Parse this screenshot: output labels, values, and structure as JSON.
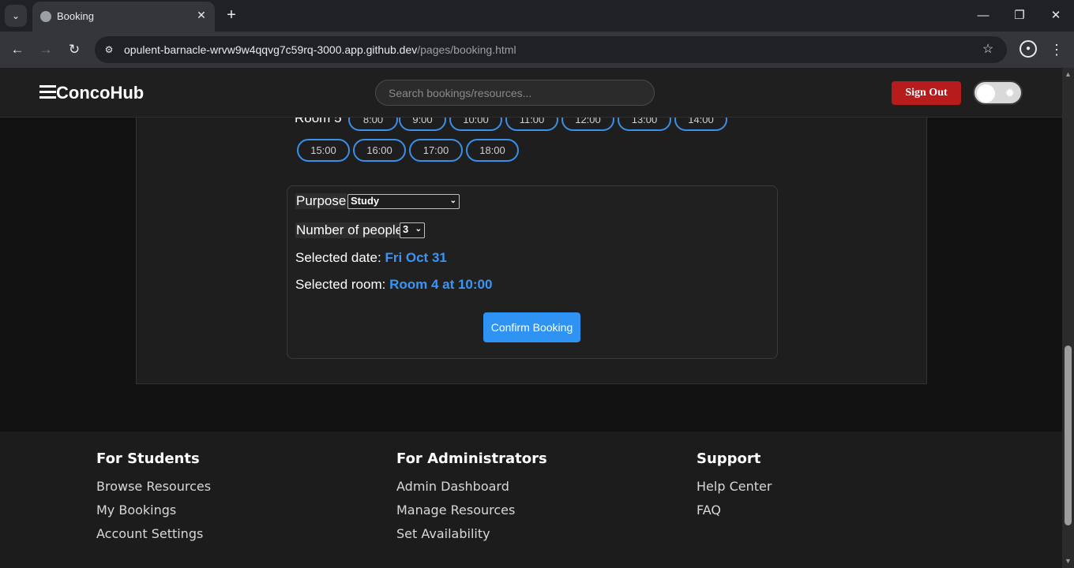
{
  "browser": {
    "tab_title": "Booking",
    "url_host": "opulent-barnacle-wrvw9w4qqvg7c59rq-3000.app.github.dev",
    "url_path": "/pages/booking.html"
  },
  "header": {
    "brand": "ConcoHub",
    "search_placeholder": "Search bookings/resources...",
    "signout_label": "Sign Out"
  },
  "booking": {
    "room5_label": "Room 5",
    "slots_row1": [
      "8:00",
      "9:00",
      "10:00",
      "11:00",
      "12:00",
      "13:00",
      "14:00"
    ],
    "slots_row2": [
      "15:00",
      "16:00",
      "17:00",
      "18:00"
    ],
    "purpose_label": "Purpose",
    "purpose_value": "Study",
    "people_label": "Number of people",
    "people_value": "3",
    "selected_date_label": "Selected date:",
    "selected_date_value": "Fri Oct 31",
    "selected_room_label": "Selected room:",
    "selected_room_value": "Room 4 at 10:00",
    "confirm_label": "Confirm Booking"
  },
  "footer": {
    "students": {
      "title": "For Students",
      "links": [
        "Browse Resources",
        "My Bookings",
        "Account Settings"
      ]
    },
    "admins": {
      "title": "For Administrators",
      "links": [
        "Admin Dashboard",
        "Manage Resources",
        "Set Availability"
      ]
    },
    "support": {
      "title": "Support",
      "links": [
        "Help Center",
        "FAQ"
      ]
    }
  },
  "colors": {
    "accent": "#2e93f2",
    "danger": "#b71c1c"
  }
}
